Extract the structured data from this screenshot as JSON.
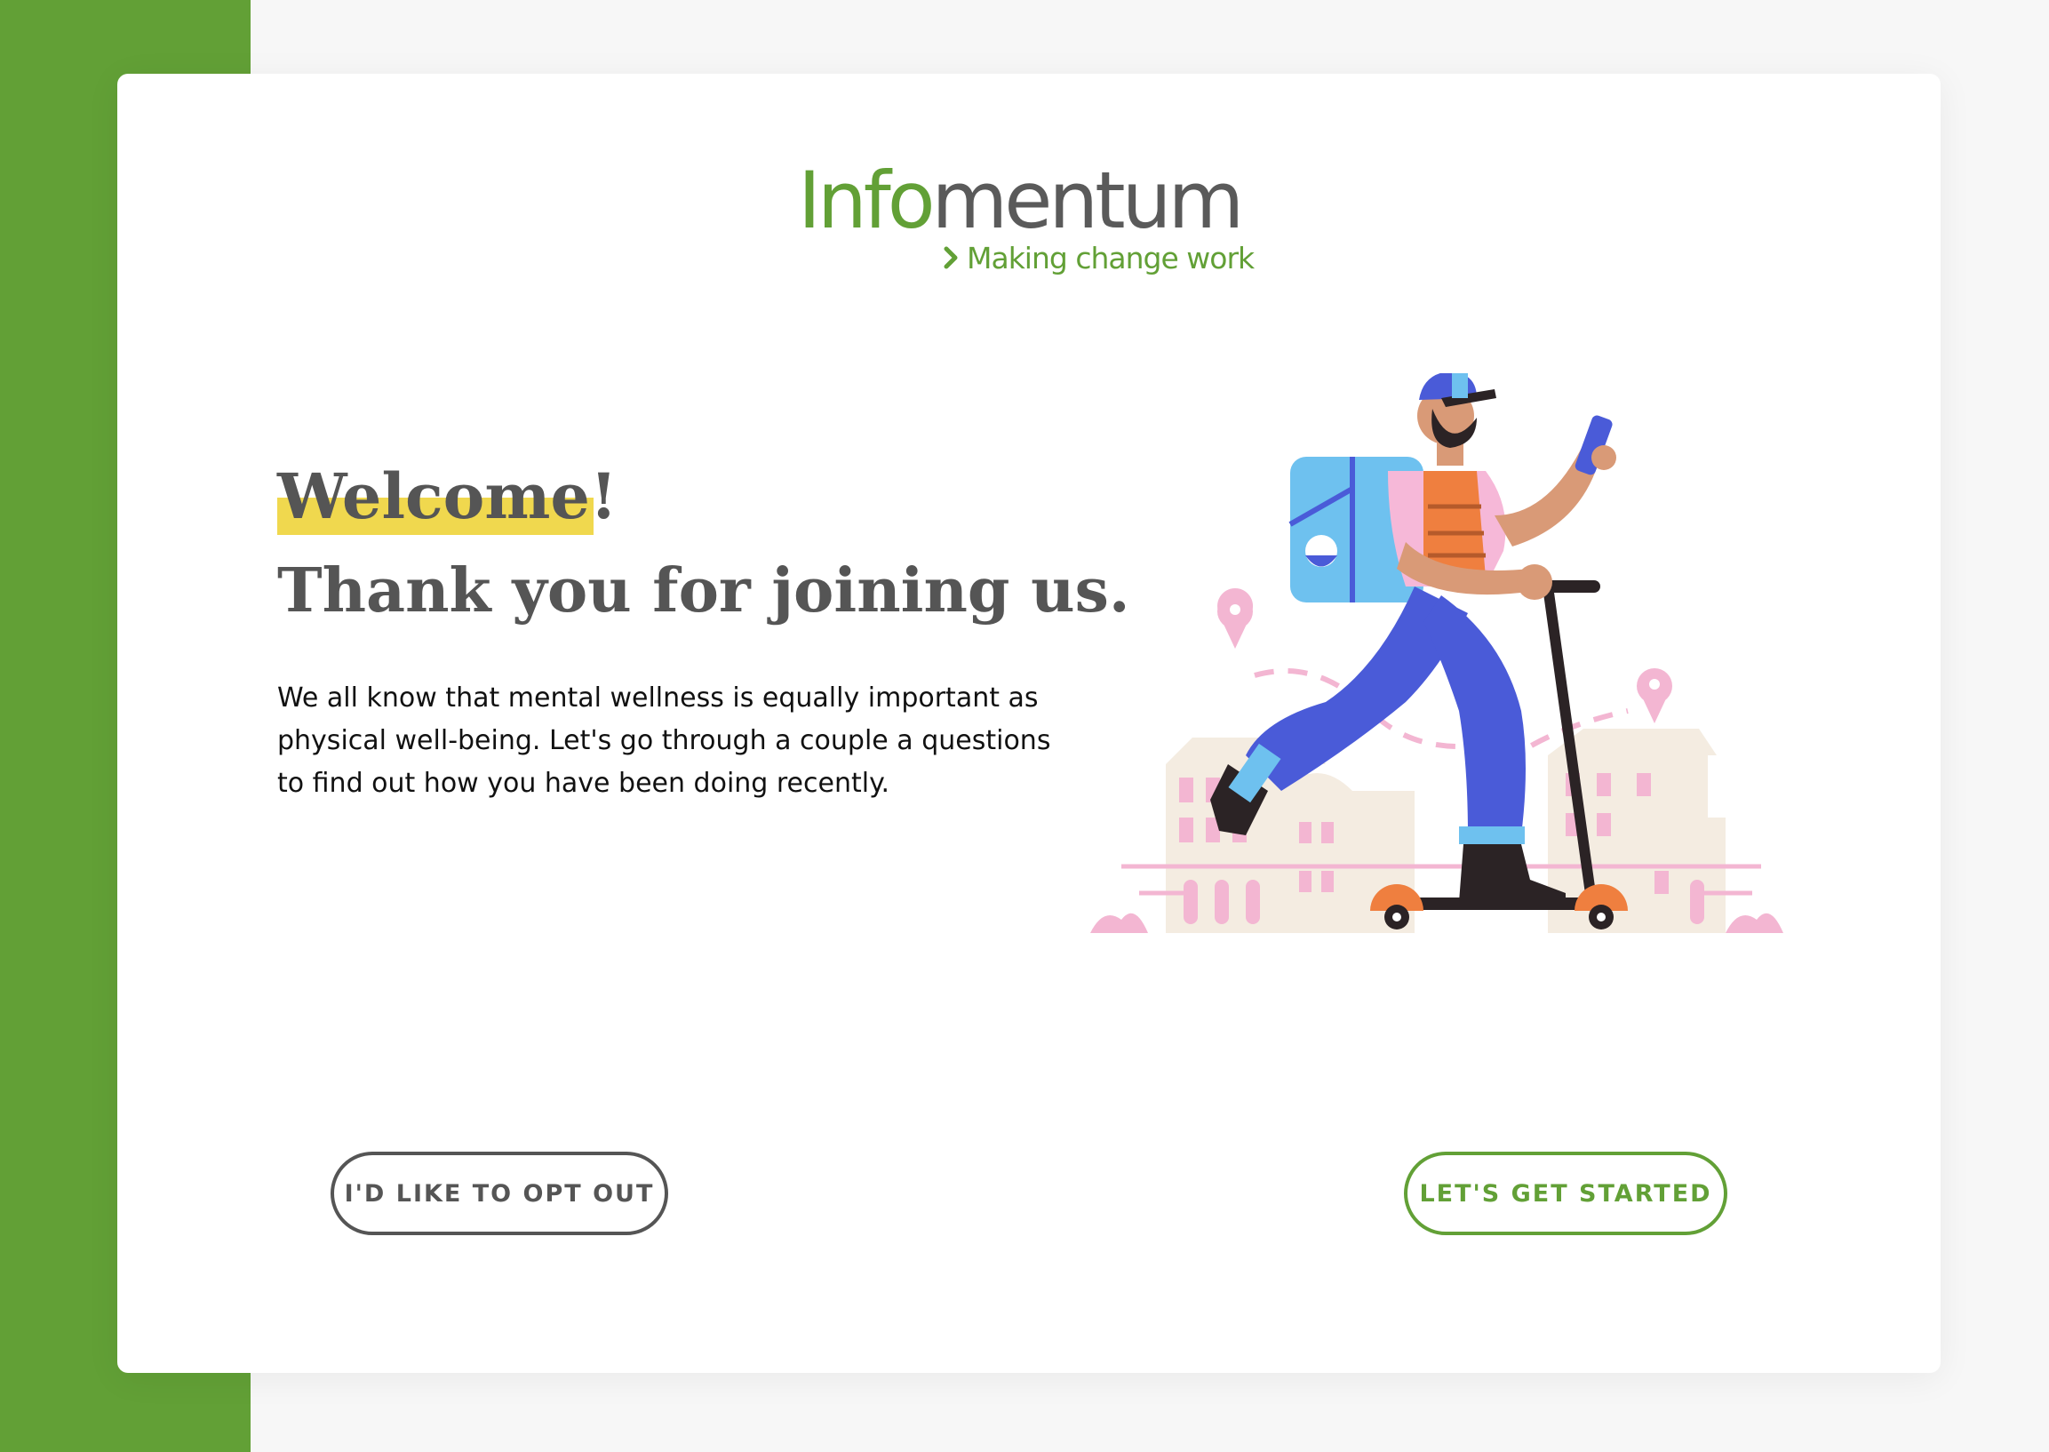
{
  "brand": {
    "name_part1": "Info",
    "name_part2": "mentum",
    "tagline": "Making change work",
    "primary_color": "#62a036",
    "text_gray": "#555555",
    "highlight_color": "#f0d84e"
  },
  "hero": {
    "welcome": "Welcome!",
    "subtitle": "Thank you for joining us.",
    "intro": "We all know that mental wellness is equally important as physical well-being. Let's go through a couple a questions to find out how you have been doing recently."
  },
  "actions": {
    "opt_out_label": "I'D LIKE TO OPT OUT",
    "start_label": "LET'S GET STARTED"
  },
  "illustration": {
    "subject": "delivery-rider-on-scooter"
  }
}
